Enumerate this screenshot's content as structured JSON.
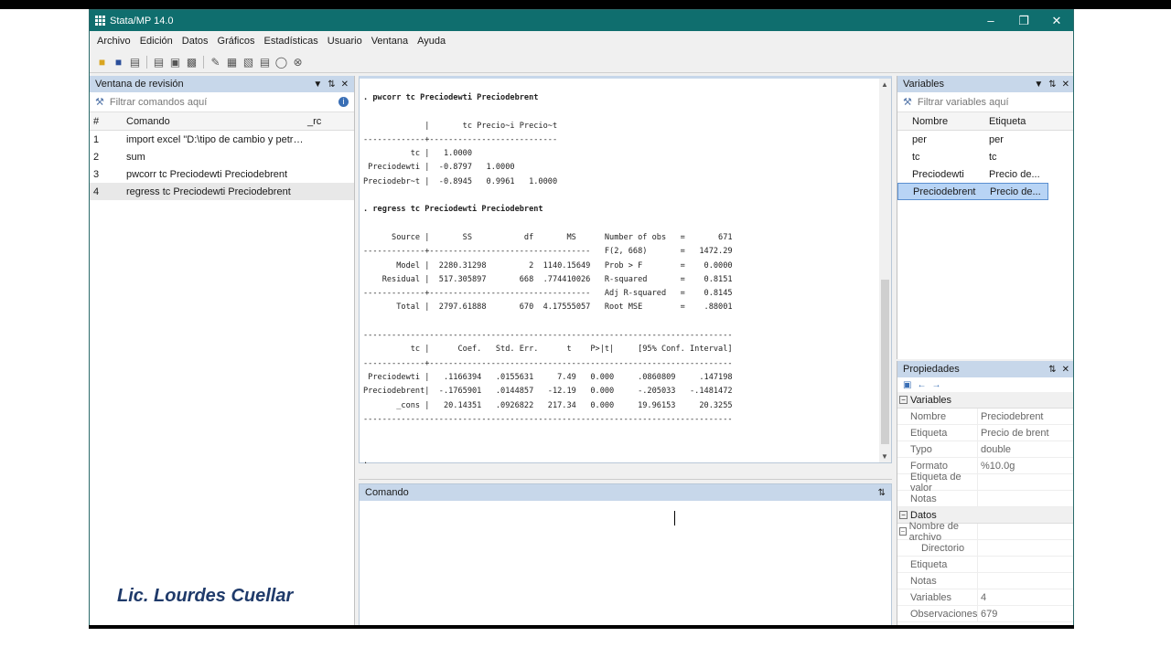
{
  "window": {
    "title": "Stata/MP 14.0",
    "controls": [
      "–",
      "❐",
      "✕"
    ]
  },
  "menu": [
    "Archivo",
    "Edición",
    "Datos",
    "Gráficos",
    "Estadísticas",
    "Usuario",
    "Ventana",
    "Ayuda"
  ],
  "review": {
    "title": "Ventana de revisión",
    "filter_placeholder": "Filtrar comandos aquí",
    "columns": [
      "#",
      "Comando",
      "_rc"
    ],
    "rows": [
      {
        "num": "1",
        "cmd": "import excel \"D:\\tipo de cambio y petroleo.x..."
      },
      {
        "num": "2",
        "cmd": "sum"
      },
      {
        "num": "3",
        "cmd": "pwcorr tc Preciodewti Preciodebrent"
      },
      {
        "num": "4",
        "cmd": "regress tc Preciodewti Preciodebrent"
      }
    ]
  },
  "results": {
    "lines": [
      ". pwcorr tc Preciodewti Preciodebrent",
      "",
      "             |       tc Precio~i Precio~t",
      "-------------+---------------------------",
      "          tc |   1.0000",
      " Preciodewti |  -0.8797   1.0000",
      "Preciodebr~t |  -0.8945   0.9961   1.0000",
      "",
      ". regress tc Preciodewti Preciodebrent",
      "",
      "      Source |       SS           df       MS      Number of obs   =       671",
      "-------------+----------------------------------   F(2, 668)       =   1472.29",
      "       Model |  2280.31298         2  1140.15649   Prob > F        =    0.0000",
      "    Residual |  517.305897       668  .774410026   R-squared       =    0.8151",
      "-------------+----------------------------------   Adj R-squared   =    0.8145",
      "       Total |  2797.61888       670  4.17555057   Root MSE        =    .88001",
      "",
      "------------------------------------------------------------------------------",
      "          tc |      Coef.   Std. Err.      t    P>|t|     [95% Conf. Interval]",
      "-------------+----------------------------------------------------------------",
      " Preciodewti |   .1166394   .0155631     7.49   0.000     .0860809     .147198",
      "Preciodebrent|  -.1765901   .0144857   -12.19   0.000     -.205033   -.1481472",
      "       _cons |   20.14351   .0926822   217.34   0.000     19.96153     20.3255",
      "------------------------------------------------------------------------------",
      "",
      "",
      "."
    ]
  },
  "command": {
    "title": "Comando"
  },
  "variables": {
    "title": "Variables",
    "filter_placeholder": "Filtrar variables aquí",
    "columns": [
      "Nombre",
      "Etiqueta"
    ],
    "rows": [
      {
        "name": "per",
        "label": "per"
      },
      {
        "name": "tc",
        "label": "tc"
      },
      {
        "name": "Preciodewti",
        "label": "Precio de..."
      },
      {
        "name": "Preciodebrent",
        "label": "Precio de..."
      }
    ]
  },
  "properties": {
    "title": "Propiedades",
    "groups": [
      {
        "name": "Variables",
        "rows": [
          {
            "k": "Nombre",
            "v": "Preciodebrent"
          },
          {
            "k": "Etiqueta",
            "v": "Precio de brent"
          },
          {
            "k": "Typo",
            "v": "double"
          },
          {
            "k": "Formato",
            "v": "%10.0g"
          },
          {
            "k": "Etiqueta de valor",
            "v": ""
          },
          {
            "k": "Notas",
            "v": ""
          }
        ]
      },
      {
        "name": "Datos",
        "rows": [
          {
            "k": "Nombre de archivo",
            "v": "",
            "box": true
          },
          {
            "k": "Directorio",
            "v": "",
            "ind": true
          },
          {
            "k": "Etiqueta",
            "v": ""
          },
          {
            "k": "Notas",
            "v": ""
          },
          {
            "k": "Variables",
            "v": "4"
          },
          {
            "k": "Observaciones",
            "v": "679"
          }
        ]
      }
    ]
  },
  "signature": "Lic. Lourdes Cuellar"
}
